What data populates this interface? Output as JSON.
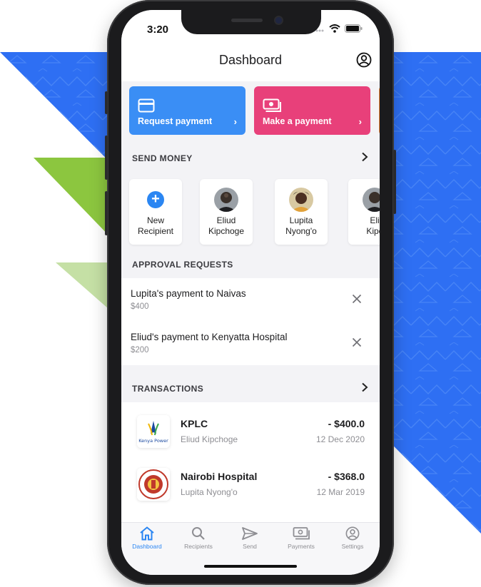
{
  "status_bar": {
    "time": "3:20"
  },
  "header": {
    "title": "Dashboard"
  },
  "actions": [
    {
      "label": "Request payment",
      "color": "#3a8ef5"
    },
    {
      "label": "Make a payment",
      "color": "#e8407a"
    }
  ],
  "send_money": {
    "title": "SEND MONEY",
    "new_recipient_line1": "New",
    "new_recipient_line2": "Recipient",
    "recipients": [
      {
        "first": "Eliud",
        "last": "Kipchoge"
      },
      {
        "first": "Lupita",
        "last": "Nyong'o"
      },
      {
        "first": "Eli",
        "last": "Kipc"
      }
    ]
  },
  "approval_requests": {
    "title": "APPROVAL REQUESTS",
    "items": [
      {
        "title": "Lupita's payment to Naivas",
        "amount": "$400"
      },
      {
        "title": "Eliud's payment to Kenyatta Hospital",
        "amount": "$200"
      }
    ]
  },
  "transactions": {
    "title": "TRANSACTIONS",
    "items": [
      {
        "name": "KPLC",
        "person": "Eliud Kipchoge",
        "amount": "- $400.0",
        "date": "12 Dec 2020",
        "logo_text": "Kenya Power"
      },
      {
        "name": "Nairobi Hospital",
        "person": "Lupita Nyong'o",
        "amount": "- $368.0",
        "date": "12 Mar 2019"
      }
    ]
  },
  "tabs": [
    {
      "label": "Dashboard",
      "icon": "home-icon",
      "active": true
    },
    {
      "label": "Recipients",
      "icon": "search-icon",
      "active": false
    },
    {
      "label": "Send",
      "icon": "send-icon",
      "active": false
    },
    {
      "label": "Payments",
      "icon": "payments-icon",
      "active": false
    },
    {
      "label": "Settings",
      "icon": "settings-icon",
      "active": false
    }
  ],
  "colors": {
    "accent": "#2b86f2",
    "background_blue": "#2e6ff3",
    "background_green": "#8cc63f",
    "background_light_green": "#c5e0a5"
  }
}
